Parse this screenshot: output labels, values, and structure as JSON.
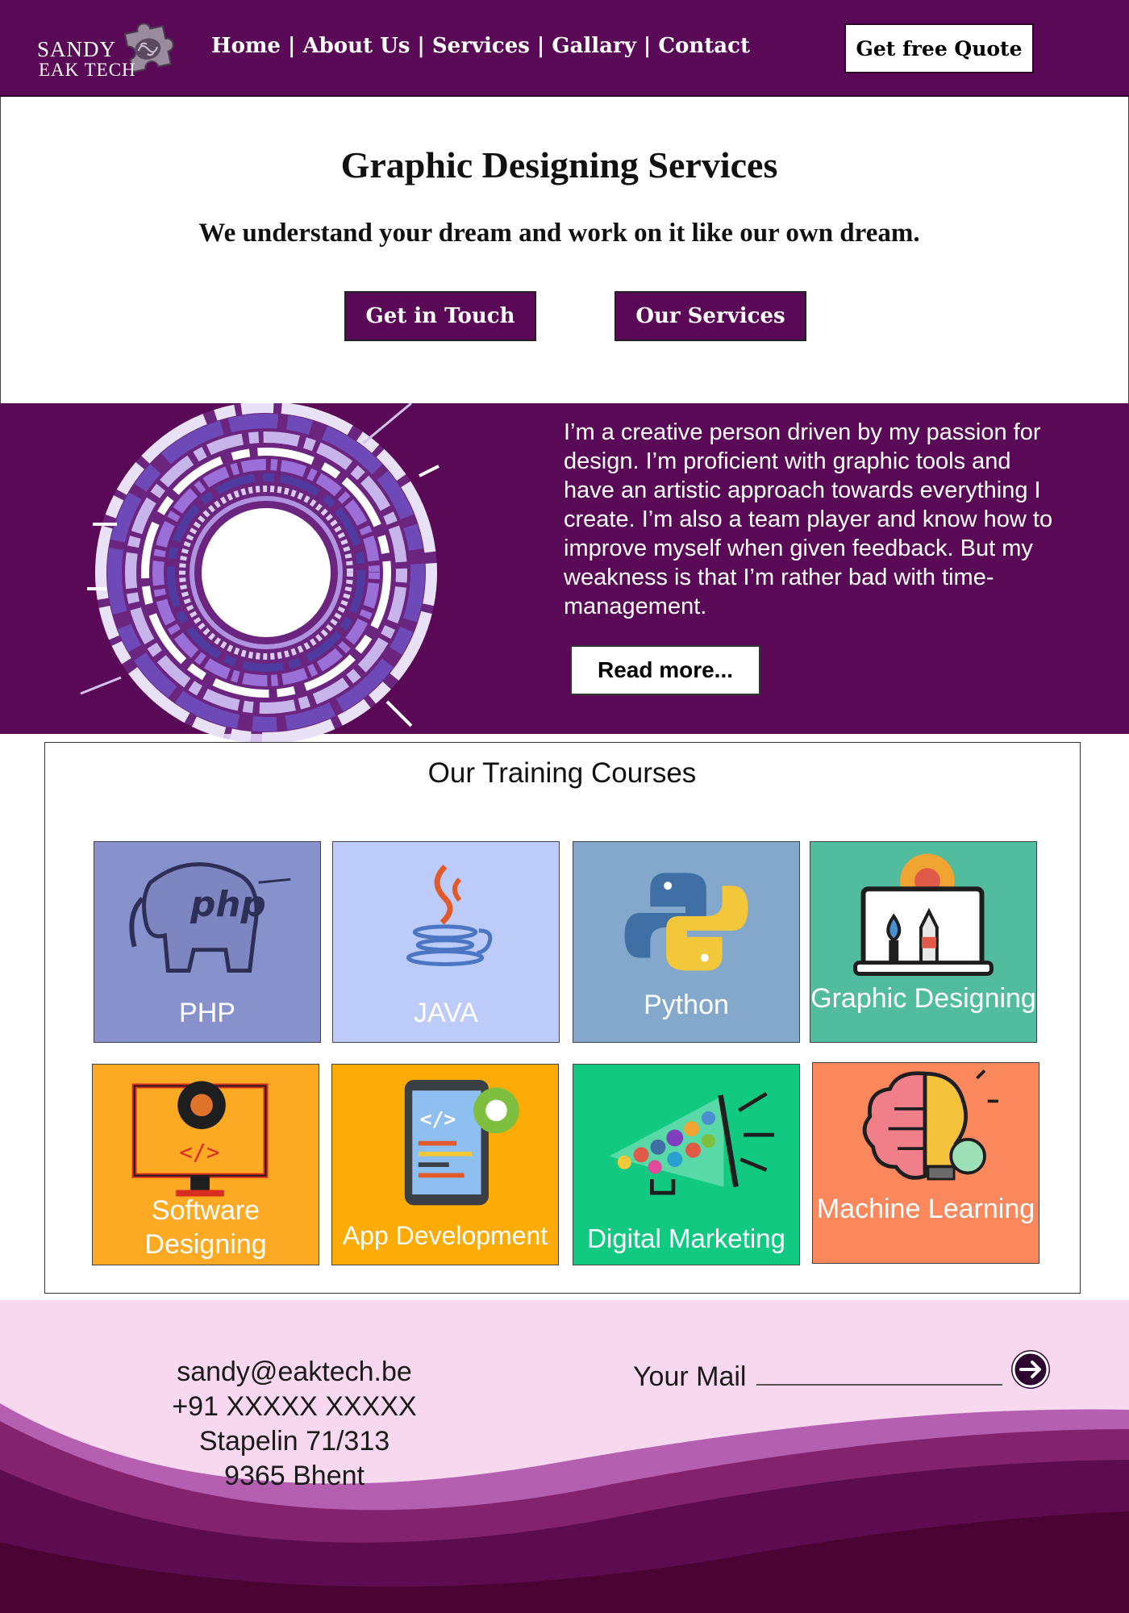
{
  "brand": {
    "line1": "SANDY",
    "line2": "EAK TECH"
  },
  "nav": {
    "items": [
      "Home",
      "About Us",
      "Services",
      "Gallary",
      "Contact"
    ],
    "separator": "|",
    "quote_button": "Get free Quote"
  },
  "hero": {
    "title": "Graphic Designing Services",
    "subtitle": "We understand your dream and work on it like our own dream.",
    "touch_button": "Get in Touch",
    "services_button": "Our Services"
  },
  "about": {
    "text": "I’m a creative person driven by my passion for design. I’m proficient with graphic tools and have an artistic approach towards everything I create. I’m also a team player and know how to improve myself when given feedback. But my weakness is that I’m rather bad with time-management.",
    "read_more": "Read more..."
  },
  "courses": {
    "title": "Our Training Courses",
    "items": [
      {
        "label": "PHP",
        "icon": "php-elephant-icon",
        "color": "#8792cd"
      },
      {
        "label": "JAVA",
        "icon": "java-cup-icon",
        "color": "#bccbf7"
      },
      {
        "label": "Python",
        "icon": "python-logo-icon",
        "color": "#84a8cc"
      },
      {
        "label": "Graphic Designing",
        "icon": "design-tools-icon",
        "color": "#52bd9e"
      },
      {
        "label": "Software Designing",
        "icon": "monitor-gear-icon",
        "color": "#fca923"
      },
      {
        "label": "App Development",
        "icon": "mobile-code-icon",
        "color": "#fcab07"
      },
      {
        "label": "Digital Marketing",
        "icon": "megaphone-icon",
        "color": "#12c981"
      },
      {
        "label": "Machine Learning",
        "icon": "brain-bulb-icon",
        "color": "#fb885d"
      }
    ]
  },
  "footer": {
    "email": "sandy@eaktech.be",
    "phone": "+91 XXXXX XXXXX",
    "address1": "Stapelin 71/313",
    "address2": "9365 Bhent",
    "mail_label": "Your Mail",
    "submit_icon": "arrow-right-circle-icon"
  },
  "colors": {
    "primary": "#5a0957",
    "footer_bg": "#f7d8ef",
    "footer_dark": "#4a0433"
  }
}
